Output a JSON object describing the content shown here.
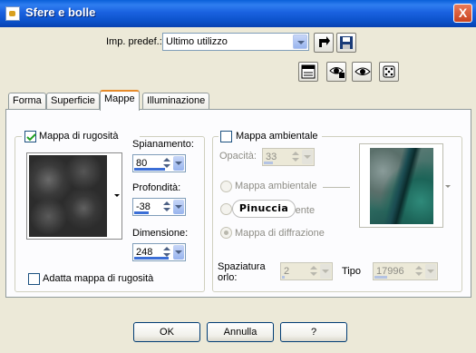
{
  "window": {
    "title": "Sfere e bolle",
    "close_symbol": "X"
  },
  "preset": {
    "label": "Imp. predef.:",
    "value": "Ultimo utilizzo",
    "icons": [
      "load-preset-icon",
      "save-preset-icon"
    ]
  },
  "toolbar": {
    "icons": [
      "layout-icon",
      "eye-toggle-icon",
      "eye-icon",
      "dice-random-icon"
    ]
  },
  "tabs": [
    {
      "label": "Forma",
      "active": false
    },
    {
      "label": "Superficie",
      "active": false
    },
    {
      "label": "Mappe",
      "active": true
    },
    {
      "label": "Illuminazione",
      "active": false
    }
  ],
  "bump_map": {
    "checkbox_label": "Mappa di rugosità",
    "checked": true,
    "smoothness": {
      "label": "Spianamento:",
      "value": "80"
    },
    "depth": {
      "label": "Profondità:",
      "value": "-38"
    },
    "size": {
      "label": "Dimensione:",
      "value": "248"
    },
    "fit_label": "Adatta mappa di rugosità",
    "fit_checked": false
  },
  "env_map": {
    "checkbox_label": "Mappa ambientale",
    "checked": false,
    "opacity": {
      "label": "Opacità:",
      "value": "33"
    },
    "radio_env": "Mappa ambientale",
    "radio_transparent_partial": "rente",
    "radio_diffraction": "Mappa di diffrazione",
    "spacing_label_1": "Spaziatura",
    "spacing_label_2": "orlo:",
    "spacing_value": "2",
    "type_label": "Tipo",
    "type_value": "17996"
  },
  "watermark": "Pinuccia",
  "buttons": {
    "ok": "OK",
    "cancel": "Annulla",
    "help": "?"
  },
  "colors": {
    "titlebar": "#0a50c8",
    "tab_accent": "#e68b2c",
    "dialog_bg": "#ece9d8"
  }
}
